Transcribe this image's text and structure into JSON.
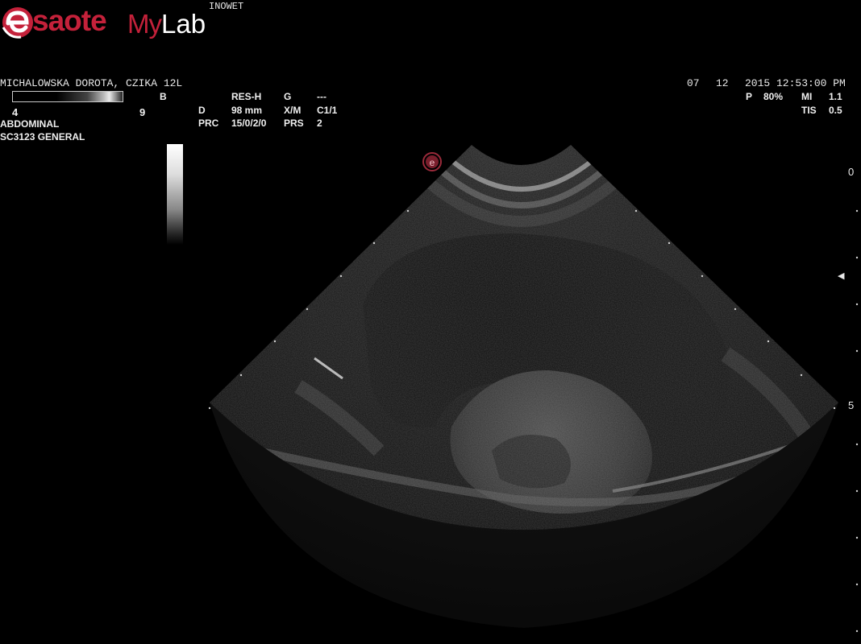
{
  "logo": {
    "brand": "saote",
    "product_my": "My",
    "product_lab": "Lab",
    "accent_color": "#c4213a"
  },
  "header": {
    "station": "INOWET",
    "patient": "MICHALOWSKA DOROTA, CZIKA 12L",
    "date_month": "07",
    "date_day": "12",
    "date_time": "2015 12:53:00 PM"
  },
  "colormap": {
    "min": "4",
    "max": "9",
    "mode": "B"
  },
  "exam": {
    "application": "ABDOMINAL",
    "probe": "SC3123  GENERAL"
  },
  "params": {
    "res_label": "RES-H",
    "g_label": "G",
    "g_value": "---",
    "d_label": "D",
    "d_value": "98 mm",
    "xm_label": "X/M",
    "xm_value": "C1/1",
    "prc_label": "PRC",
    "prc_value": "15/0/2/0",
    "prs_label": "PRS",
    "prs_value": "2",
    "p_label": "P",
    "p_value": "80%",
    "mi_label": "MI",
    "mi_value": "1.1",
    "tis_label": "TIS",
    "tis_value": "0.5"
  },
  "depth_scale": {
    "top": "0",
    "mid": "5"
  },
  "focus_marker": "◀"
}
